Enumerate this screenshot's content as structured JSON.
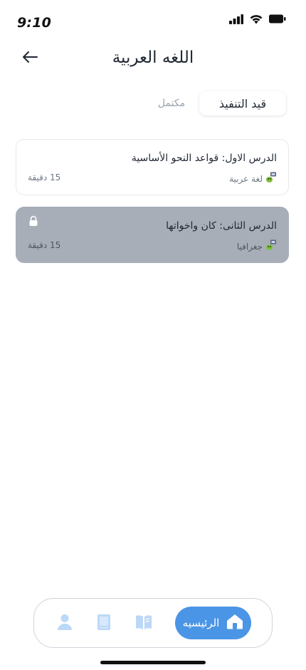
{
  "status_bar": {
    "time": "9:10"
  },
  "header": {
    "title": "اللغه العربية"
  },
  "tabs": [
    {
      "label": "قيد التنفيذ",
      "active": true
    },
    {
      "label": "مكتمل",
      "active": false
    }
  ],
  "lessons": [
    {
      "title": "الدرس الاول: قواعد النحو الأساسية",
      "subject": "لغة عربية",
      "duration": "15 دقيقة",
      "locked": false
    },
    {
      "title": "الدرس الثانى: كان واخواتها",
      "subject": "جغرافيا",
      "duration": "15 دقيقة",
      "locked": true
    }
  ],
  "bottom_nav": {
    "home_label": "الرئيسيه",
    "items": [
      "profile-icon",
      "book-icon",
      "open-book-icon",
      "home-icon"
    ]
  },
  "colors": {
    "accent": "#4b95e6",
    "locked_card": "#a7aeb8",
    "nav_icon": "#bcd8f7"
  }
}
